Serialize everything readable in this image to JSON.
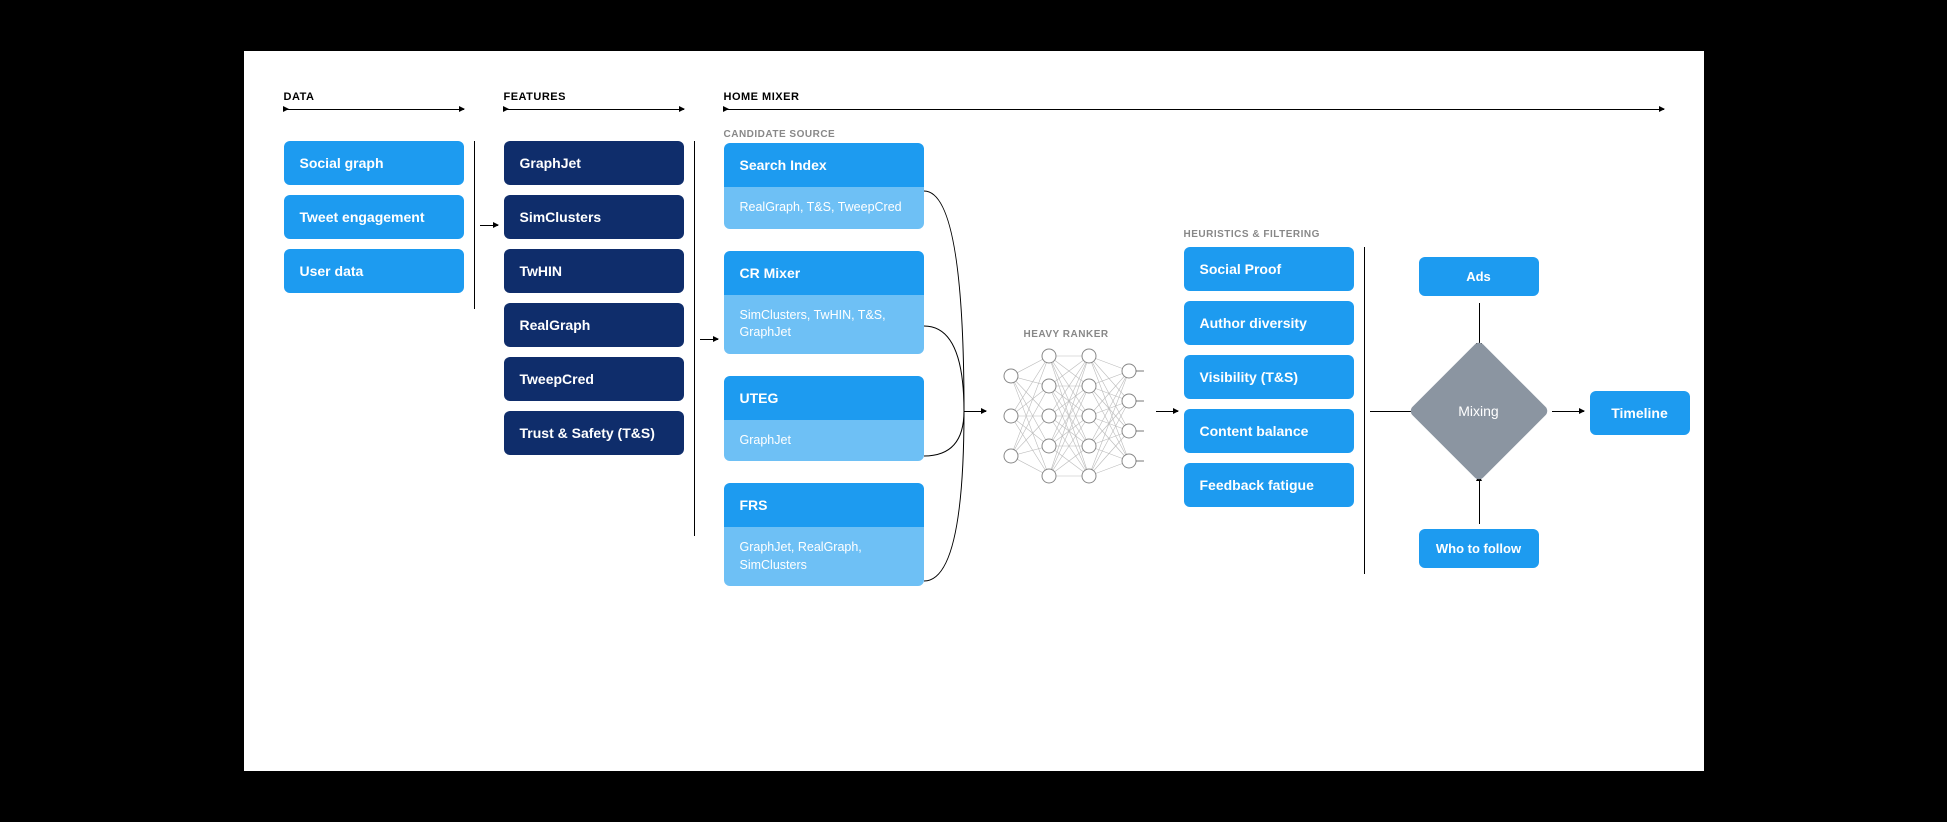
{
  "sections": {
    "data": "DATA",
    "features": "FEATURES",
    "home_mixer": "HOME MIXER"
  },
  "sub_sections": {
    "candidate_source": "CANDIDATE SOURCE",
    "heavy_ranker": "HEAVY RANKER",
    "heuristics": "HEURISTICS & FILTERING"
  },
  "data_col": [
    "Social graph",
    "Tweet engagement",
    "User data"
  ],
  "features_col": [
    "GraphJet",
    "SimClusters",
    "TwHIN",
    "RealGraph",
    "TweepCred",
    "Trust & Safety (T&S)"
  ],
  "candidate_sources": [
    {
      "title": "Search Index",
      "sub": "RealGraph, T&S, TweepCred"
    },
    {
      "title": "CR Mixer",
      "sub": "SimClusters, TwHIN, T&S, GraphJet"
    },
    {
      "title": "UTEG",
      "sub": "GraphJet"
    },
    {
      "title": "FRS",
      "sub": "GraphJet, RealGraph, SimClusters"
    }
  ],
  "heuristics_col": [
    "Social Proof",
    "Author diversity",
    "Visibility (T&S)",
    "Content balance",
    "Feedback fatigue"
  ],
  "inputs": {
    "ads": "Ads",
    "wtf": "Who to follow"
  },
  "mixing": "Mixing",
  "output": "Timeline",
  "colors": {
    "light_blue": "#1d9bf0",
    "dark_blue": "#0f2d6b",
    "pale_blue": "#6ec0f5",
    "diamond_gray": "#8b95a1"
  }
}
